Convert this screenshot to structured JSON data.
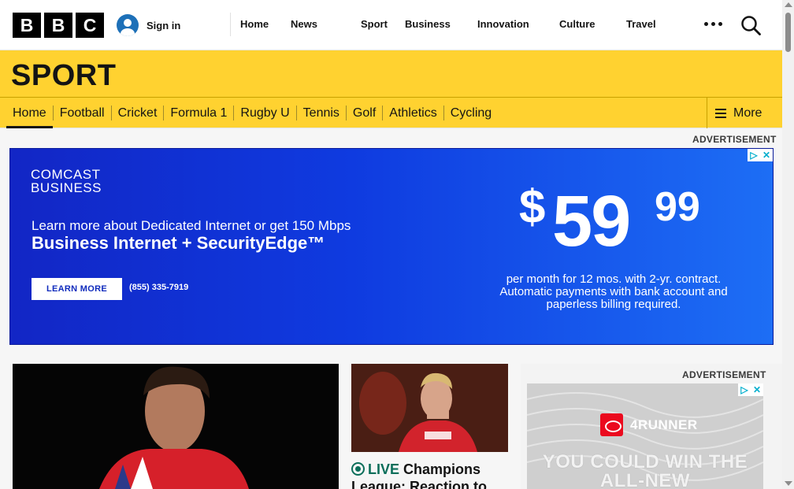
{
  "header": {
    "logo_letters": [
      "B",
      "B",
      "C"
    ],
    "signin_label": "Sign in",
    "nav": [
      "Home",
      "News",
      "Sport",
      "Business",
      "Innovation",
      "Culture",
      "Travel"
    ],
    "more_icon": "ellipsis-icon",
    "search_icon": "search-icon"
  },
  "section": {
    "title": "SPORT",
    "subnav": [
      "Home",
      "Football",
      "Cricket",
      "Formula 1",
      "Rugby U",
      "Tennis",
      "Golf",
      "Athletics",
      "Cycling"
    ],
    "active_item": "Home",
    "more_label": "More"
  },
  "ads": {
    "label": "ADVERTISEMENT",
    "banner": {
      "brand_line1": "COMCAST",
      "brand_line2": "BUSINESS",
      "line1": "Learn more about Dedicated Internet or get 150 Mbps",
      "line2": "Business Internet + SecurityEdge™",
      "cta": "LEARN MORE",
      "phone": "(855) 335-7919",
      "price_symbol": "$",
      "price_main": "59",
      "price_cents": "99",
      "fine_print": "per month for 12 mos. with 2-yr. contract. Automatic payments with bank account and paperless billing required.",
      "colors": {
        "background": "#1226c5",
        "accent": "#1d6ef5"
      }
    },
    "side": {
      "label": "ADVERTISEMENT",
      "brand": "4RUNNER",
      "headline": "YOU COULD WIN THE ALL-NEW"
    }
  },
  "stories": {
    "card2": {
      "live_label": "LIVE",
      "title": "Champions League: Reaction to"
    }
  },
  "colors": {
    "sport_yellow": "#ffd230",
    "live_green": "#0b6e5a",
    "bbc_black": "#000000"
  }
}
